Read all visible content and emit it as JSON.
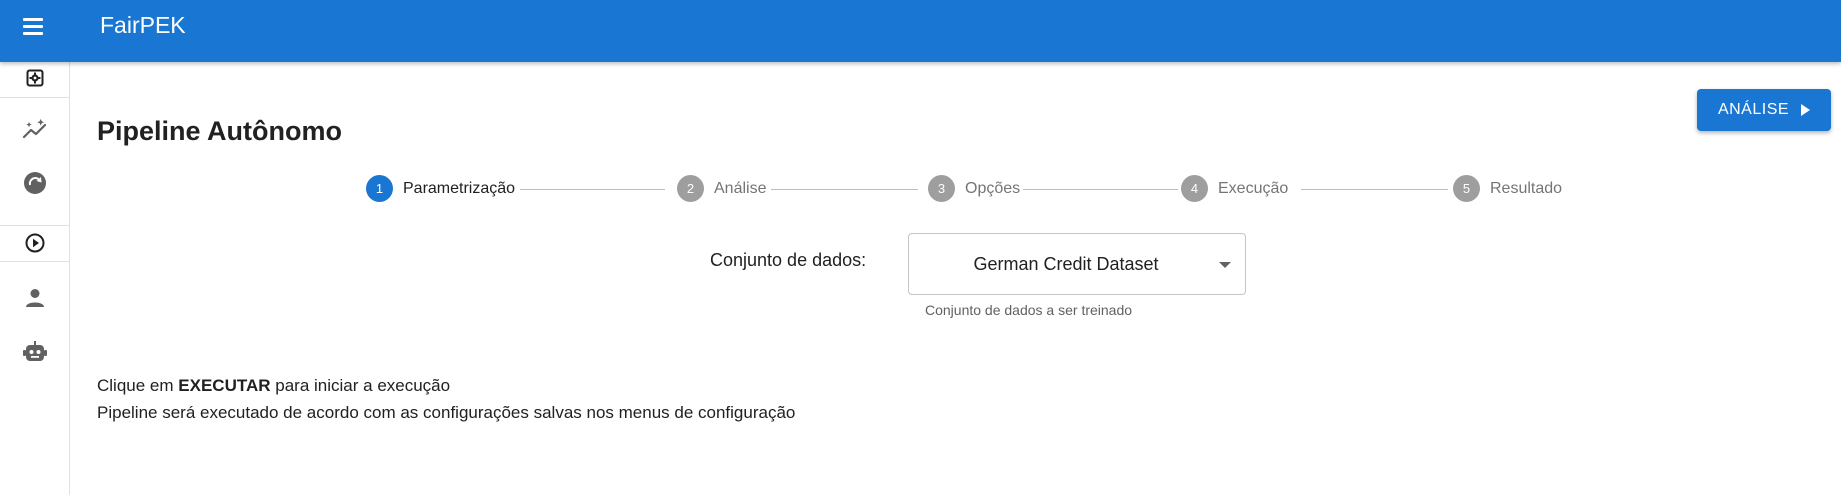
{
  "app": {
    "title": "FairPEK"
  },
  "sidebar": {
    "items": [
      {
        "icon": "settings-box-icon"
      },
      {
        "icon": "auto-graph-icon"
      },
      {
        "icon": "refresh-circle-icon"
      },
      {
        "icon": "play-circle-icon"
      },
      {
        "icon": "person-icon"
      },
      {
        "icon": "robot-icon"
      }
    ]
  },
  "page": {
    "title": "Pipeline Autônomo"
  },
  "actions": {
    "analysis_label": "ANÁLISE"
  },
  "stepper": {
    "active_step": 1,
    "steps": [
      {
        "number": "1",
        "label": "Parametrização"
      },
      {
        "number": "2",
        "label": "Análise"
      },
      {
        "number": "3",
        "label": "Opções"
      },
      {
        "number": "4",
        "label": "Execução"
      },
      {
        "number": "5",
        "label": "Resultado"
      }
    ]
  },
  "dataset": {
    "label": "Conjunto de dados:",
    "value": "German Credit Dataset",
    "helper": "Conjunto de dados a ser treinado"
  },
  "instructions": {
    "line1_prefix": "Clique em",
    "line1_bold": "EXECUTAR",
    "line1_suffix": "para iniciar a execução",
    "line2": "Pipeline será executado de acordo com as configurações salvas nos menus de configuração"
  },
  "colors": {
    "primary": "#1976d2",
    "step_inactive": "#9e9e9e",
    "text": "#212121"
  }
}
